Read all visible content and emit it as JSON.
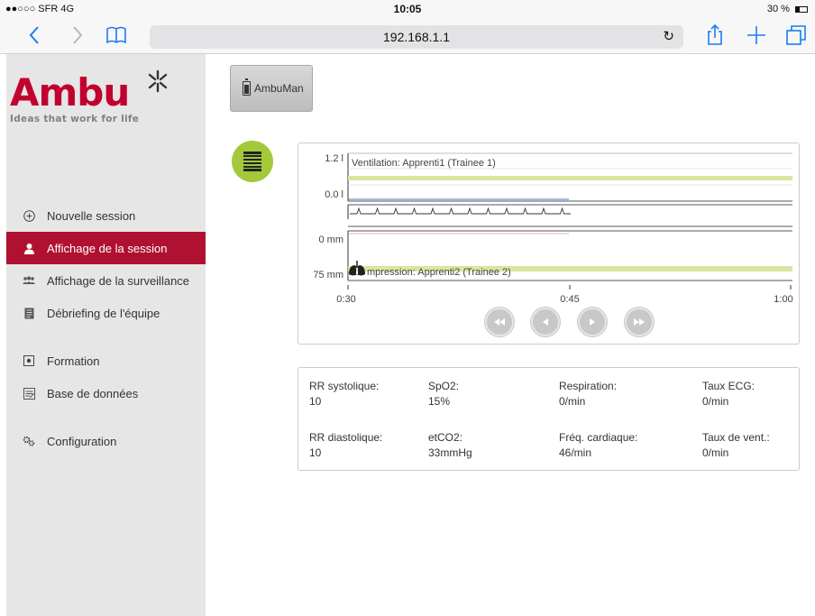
{
  "status": {
    "carrier": "●●○○○ SFR  4G",
    "time": "10:05",
    "battery": "30 %"
  },
  "browser": {
    "url": "192.168.1.1"
  },
  "logo": {
    "word": "Ambu",
    "tagline": "Ideas that work for life",
    "color": "#c2002f"
  },
  "sidebar": {
    "items": [
      {
        "label": "Nouvelle session",
        "icon": "plus-circle-icon"
      },
      {
        "label": "Affichage de la session",
        "icon": "user-icon",
        "active": true
      },
      {
        "label": "Affichage de la surveillance",
        "icon": "users-icon"
      },
      {
        "label": "Débriefing de l'équipe",
        "icon": "document-icon"
      },
      {
        "label": "Formation",
        "icon": "training-icon"
      },
      {
        "label": "Base de données",
        "icon": "database-icon"
      },
      {
        "label": "Configuration",
        "icon": "gears-icon"
      }
    ],
    "active_color": "#b01131"
  },
  "device_button": {
    "label": "AmbuMan"
  },
  "chart": {
    "ventilation_label": "Ventilation: Apprenti1 (Trainee 1)",
    "compression_label": "mpression: Apprenti2 (Trainee 2)",
    "vent_top_tick": "1.2 l",
    "vent_bottom_tick": "0.0 l",
    "comp_top_tick": "0 mm",
    "comp_bottom_tick": "75 mm",
    "time_ticks": [
      "0:30",
      "0:45",
      "1:00"
    ],
    "band_color": "#d7e6a0"
  },
  "playback": [
    "rewind-icon",
    "step-back-icon",
    "play-icon",
    "fast-forward-icon"
  ],
  "stats": [
    {
      "label": "RR systolique:",
      "value": "10"
    },
    {
      "label": "SpO2:",
      "value": "15%"
    },
    {
      "label": "Respiration:",
      "value": "0/min"
    },
    {
      "label": "Taux ECG:",
      "value": "0/min"
    },
    {
      "label": "RR diastolique:",
      "value": "10"
    },
    {
      "label": "etCO2:",
      "value": "33mmHg"
    },
    {
      "label": "Fréq. cardiaque:",
      "value": "46/min"
    },
    {
      "label": "Taux de vent.:",
      "value": "0/min"
    }
  ]
}
